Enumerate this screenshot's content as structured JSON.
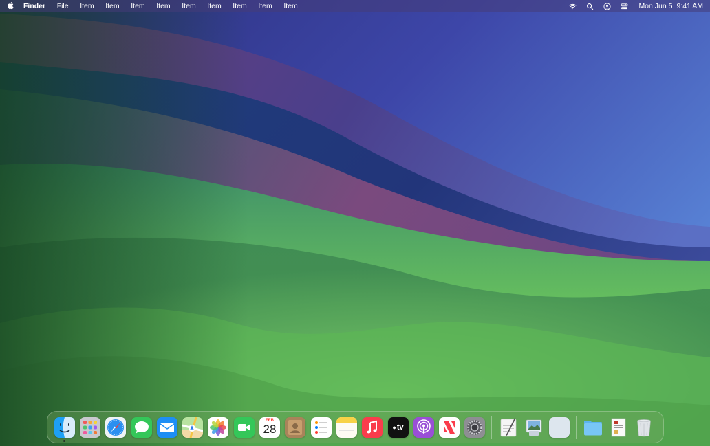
{
  "menubar": {
    "apple_icon": "apple-logo-icon",
    "app_name": "Finder",
    "menus": [
      "File",
      "Item",
      "Item",
      "Item",
      "Item",
      "Item",
      "Item",
      "Item",
      "Item",
      "Item"
    ],
    "status_icons": [
      "wifi-icon",
      "search-icon",
      "user-icon",
      "control-center-icon"
    ],
    "date": "Mon Jun 5",
    "time": "9:41 AM"
  },
  "calendar": {
    "month": "FEB",
    "day": "28"
  },
  "tv": {
    "label": "tv"
  },
  "dock": {
    "apps": [
      {
        "name": "finder",
        "running": true
      },
      {
        "name": "launchpad"
      },
      {
        "name": "safari"
      },
      {
        "name": "messages"
      },
      {
        "name": "mail"
      },
      {
        "name": "maps"
      },
      {
        "name": "photos"
      },
      {
        "name": "facetime"
      },
      {
        "name": "calendar"
      },
      {
        "name": "contacts"
      },
      {
        "name": "reminders"
      },
      {
        "name": "notes"
      },
      {
        "name": "music"
      },
      {
        "name": "tv"
      },
      {
        "name": "podcasts"
      },
      {
        "name": "news"
      },
      {
        "name": "system-settings"
      },
      {
        "name": "textedit"
      },
      {
        "name": "preview"
      },
      {
        "name": "blank-app"
      },
      {
        "name": "folder"
      },
      {
        "name": "document"
      },
      {
        "name": "trash"
      }
    ]
  },
  "colors": {
    "menubar_bg": "#463c78",
    "wallpaper_purple": "#4b3f8f",
    "wallpaper_blue": "#1e3a78",
    "wallpaper_green": "#6cc05a"
  }
}
